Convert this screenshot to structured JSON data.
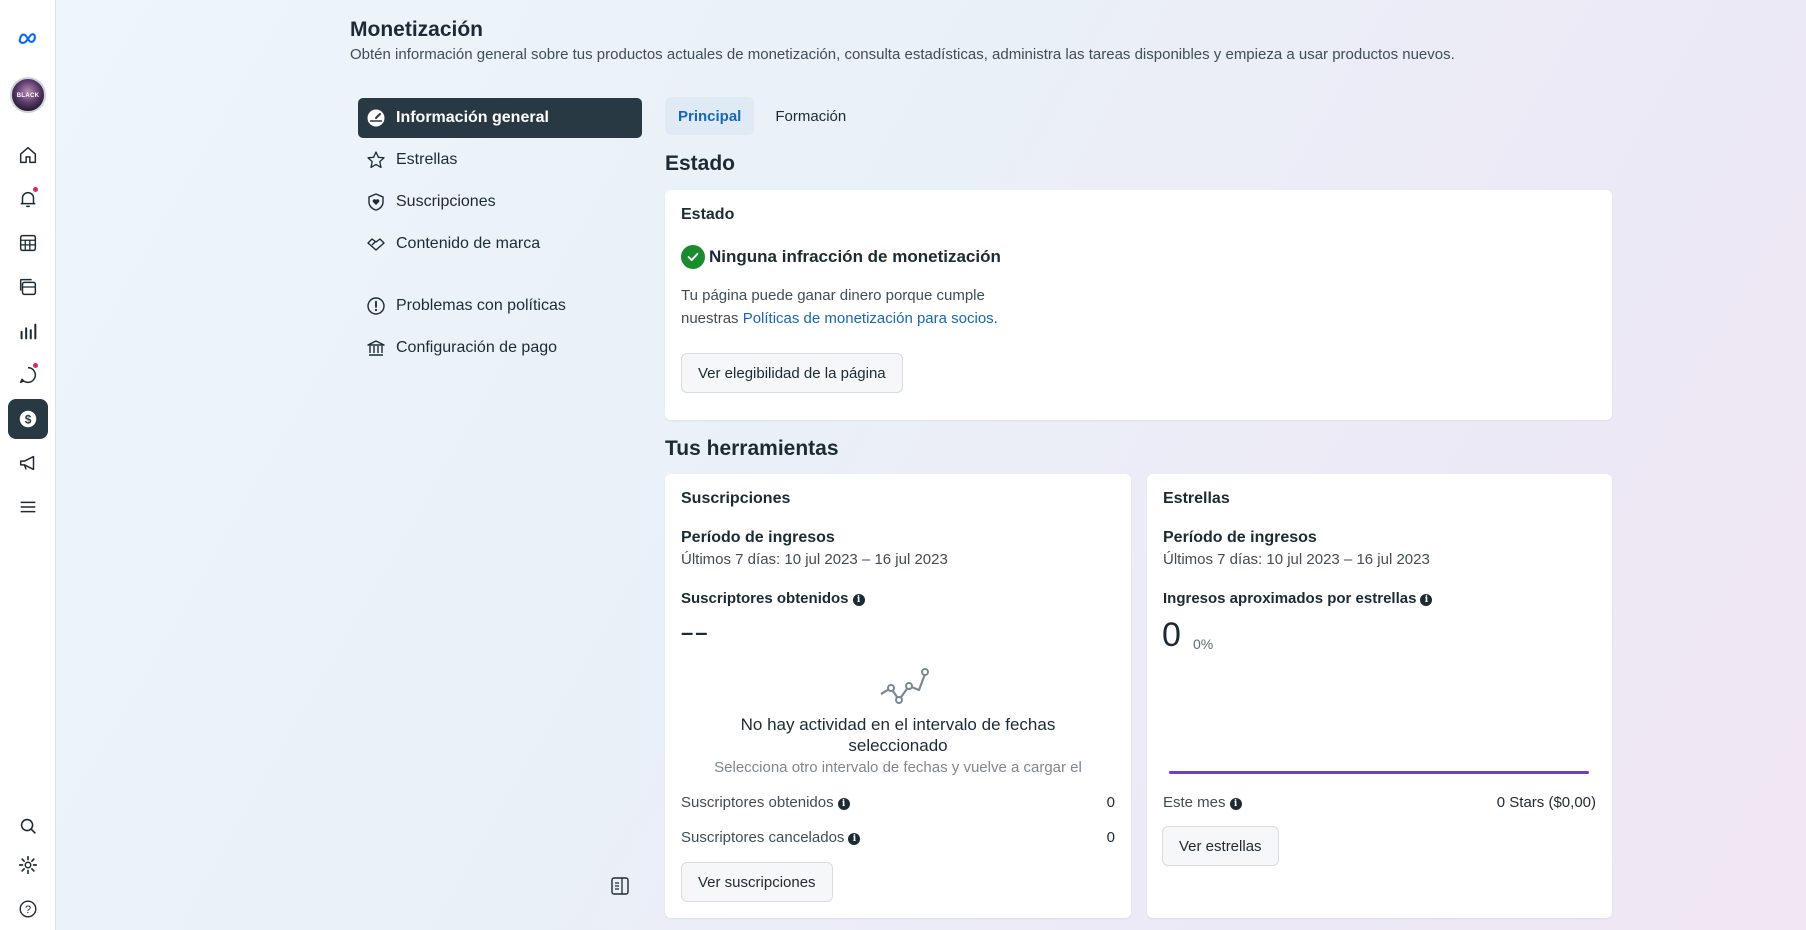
{
  "header": {
    "title": "Monetización",
    "subtitle": "Obtén información general sobre tus productos actuales de monetización, consulta estadísticas, administra las tareas disponibles y empieza a usar productos nuevos."
  },
  "avatar": {
    "text": "BLACK"
  },
  "menu": {
    "items": [
      {
        "label": "Información general"
      },
      {
        "label": "Estrellas"
      },
      {
        "label": "Suscripciones"
      },
      {
        "label": "Contenido de marca"
      },
      {
        "label": "Problemas con políticas"
      },
      {
        "label": "Configuración de pago"
      }
    ]
  },
  "tabs": [
    {
      "label": "Principal"
    },
    {
      "label": "Formación"
    }
  ],
  "estado": {
    "section_title": "Estado",
    "card_title": "Estado",
    "status": "Ninguna infracción de monetización",
    "text_before": "Tu página puede ganar dinero porque cumple nuestras ",
    "link": "Políticas de monetización para socios",
    "text_after": ".",
    "button": "Ver elegibilidad de la página"
  },
  "tools": {
    "section_title": "Tus herramientas",
    "subscriptions": {
      "title": "Suscripciones",
      "period_label": "Período de ingresos",
      "period_value": "Últimos 7 días: 10 jul 2023 – 16 jul 2023",
      "metric_label": "Suscriptores obtenidos",
      "metric_value": "––",
      "empty_title": "No hay actividad en el intervalo de fechas seleccionado",
      "empty_sub": "Selecciona otro intervalo de fechas y vuelve a cargar el",
      "rows": [
        {
          "label": "Suscriptores obtenidos",
          "value": "0"
        },
        {
          "label": "Suscriptores cancelados",
          "value": "0"
        }
      ],
      "button": "Ver suscripciones"
    },
    "stars": {
      "title": "Estrellas",
      "period_label": "Período de ingresos",
      "period_value": "Últimos 7 días: 10 jul 2023 – 16 jul 2023",
      "metric_label": "Ingresos aproximados por estrellas",
      "metric_value": "0",
      "metric_pct": "0%",
      "row": {
        "label": "Este mes",
        "value": "0 Stars ($0,00)"
      },
      "button": "Ver estrellas"
    }
  },
  "colors": {
    "active_nav": "#283943",
    "accent_blue": "#1667b9",
    "success_green": "#1a8c2e",
    "chart_purple": "#6b3fc7",
    "notification_red": "#e0245e"
  },
  "icons": {
    "rail": [
      "meta-logo-icon",
      "home-icon",
      "bell-icon",
      "calendar-grid-icon",
      "stack-icon",
      "bar-chart-icon",
      "chat-bubble-icon",
      "dollar-icon",
      "megaphone-icon",
      "menu-icon",
      "search-icon",
      "gear-icon",
      "help-icon"
    ],
    "menu": [
      "dashboard-icon",
      "star-icon",
      "shield-heart-icon",
      "handshake-icon",
      "alert-circle-icon",
      "bank-icon"
    ]
  }
}
